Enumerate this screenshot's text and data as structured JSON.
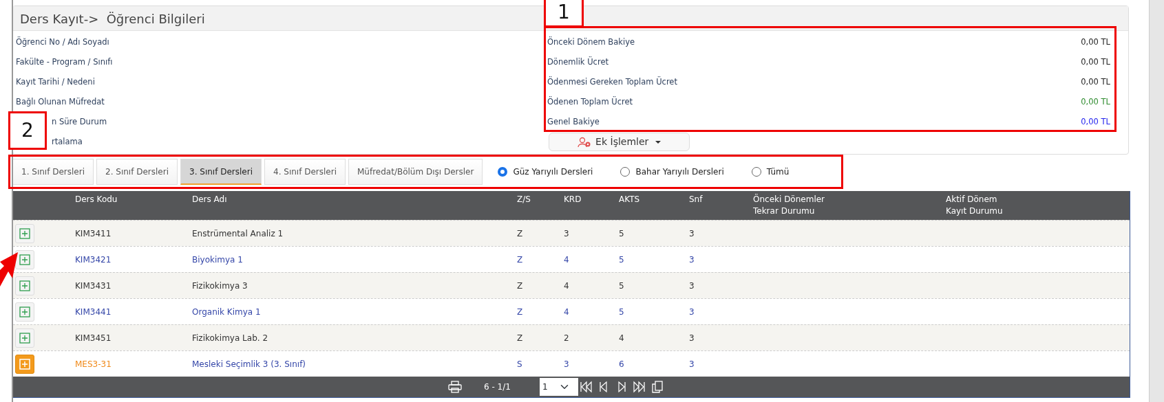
{
  "panel": {
    "title": "Ders Kayıt->  Öğrenci Bilgileri"
  },
  "student_fields": [
    {
      "label": "Öğrenci No / Adı Soyadı"
    },
    {
      "label": "Fakülte - Program / Sınıfı"
    },
    {
      "label": "Kayıt Tarihi / Nedeni"
    },
    {
      "label": "Bağlı Olunan Müfredat"
    },
    {
      "label": "n Süre Durum"
    },
    {
      "label": "rtalama"
    }
  ],
  "fees": [
    {
      "label": "Önceki Dönem Bakiye",
      "value": "0,00 TL",
      "color": "#222222"
    },
    {
      "label": "Dönemlik Ücret",
      "value": "0,00 TL",
      "color": "#222222"
    },
    {
      "label": "Ödenmesi Gereken Toplam Ücret",
      "value": "0,00 TL",
      "color": "#222222"
    },
    {
      "label": "Ödenen Toplam Ücret",
      "value": "0,00 TL",
      "color": "#2e8b2e"
    },
    {
      "label": "Genel Bakiye",
      "value": "0,00 TL",
      "color": "#2323ee"
    }
  ],
  "extra_button": {
    "label": "Ek İşlemler"
  },
  "class_tabs": [
    {
      "label": "1. Sınıf Dersleri",
      "selected": false
    },
    {
      "label": "2. Sınıf Dersleri",
      "selected": false
    },
    {
      "label": "3. Sınıf Dersleri",
      "selected": true
    },
    {
      "label": "4. Sınıf Dersleri",
      "selected": false
    },
    {
      "label": "Müfredat/Bölüm Dışı Dersler",
      "selected": false
    }
  ],
  "semester_filter": [
    {
      "label": "Güz Yarıyılı Dersleri",
      "selected": true
    },
    {
      "label": "Bahar Yarıyılı Dersleri",
      "selected": false
    },
    {
      "label": "Tümü",
      "selected": false
    }
  ],
  "table": {
    "columns": [
      "Ders Kodu",
      "Ders Adı",
      "Z/S",
      "KRD",
      "AKTS",
      "Snf",
      "Önceki Dönemler\nTekrar Durumu",
      "Aktif Dönem\nKayıt Durumu"
    ],
    "rows": [
      {
        "kind": "course",
        "code": "KIM3411",
        "name": "Enstrümental Analiz 1",
        "zs": "Z",
        "krd": "3",
        "akts": "5",
        "snf": "3"
      },
      {
        "kind": "course",
        "code": "KIM3421",
        "name": "Biyokimya 1",
        "zs": "Z",
        "krd": "4",
        "akts": "5",
        "snf": "3"
      },
      {
        "kind": "course",
        "code": "KIM3431",
        "name": "Fizikokimya 3",
        "zs": "Z",
        "krd": "4",
        "akts": "5",
        "snf": "3"
      },
      {
        "kind": "course",
        "code": "KIM3441",
        "name": "Organik Kimya 1",
        "zs": "Z",
        "krd": "4",
        "akts": "5",
        "snf": "3"
      },
      {
        "kind": "course",
        "code": "KIM3451",
        "name": "Fizikokimya Lab. 2",
        "zs": "Z",
        "krd": "2",
        "akts": "4",
        "snf": "3"
      },
      {
        "kind": "elective",
        "code": "MES3-31",
        "name": "Mesleki Seçimlik 3 (3. Sınıf)",
        "zs": "S",
        "krd": "3",
        "akts": "6",
        "snf": "3"
      }
    ]
  },
  "pager": {
    "summary": "6 - 1/1",
    "page": "1"
  },
  "annotations": [
    {
      "label": "1"
    },
    {
      "label": "2"
    }
  ]
}
